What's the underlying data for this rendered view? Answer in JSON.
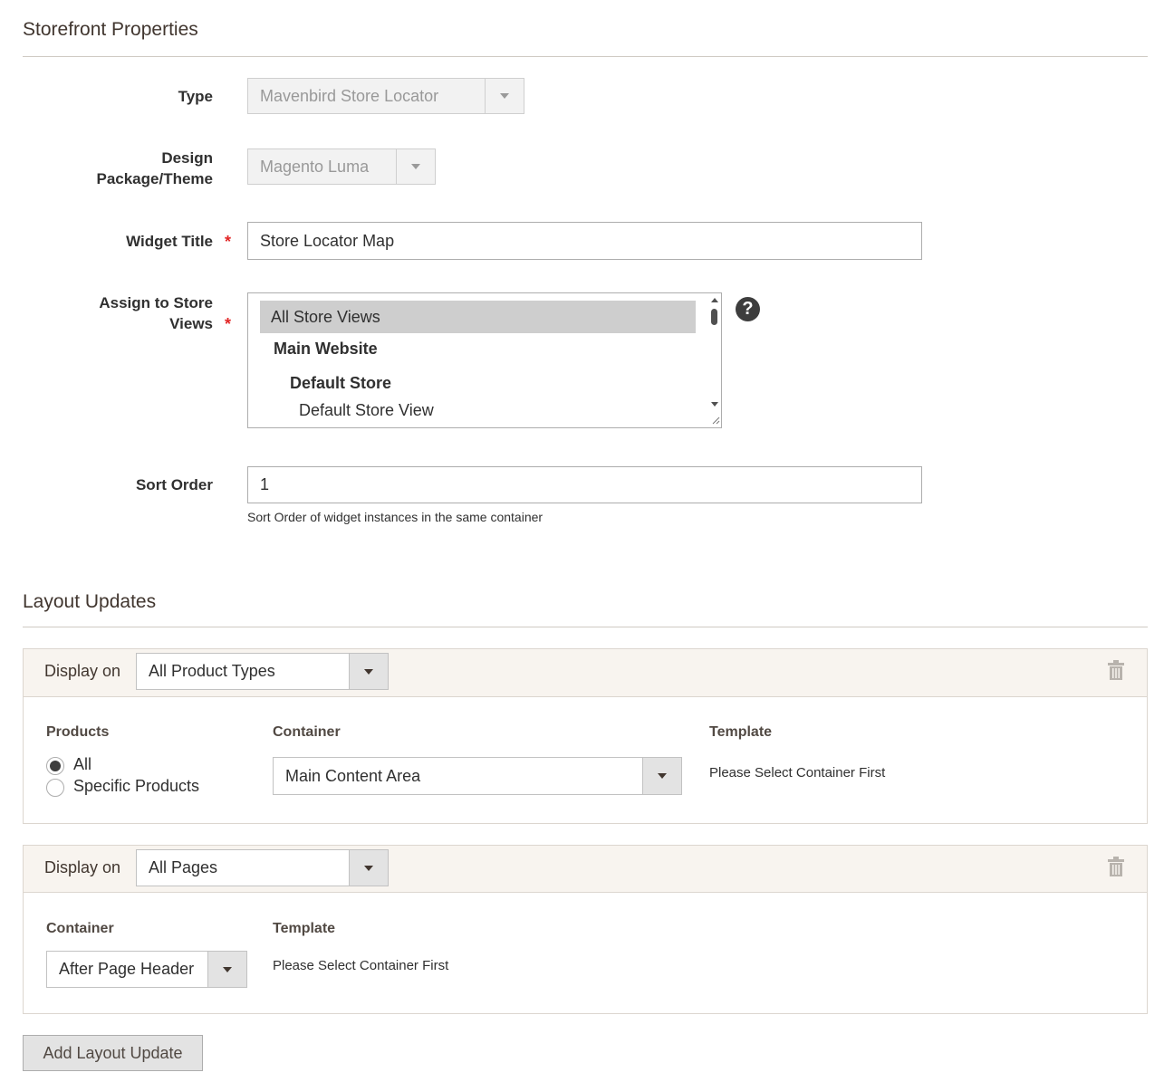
{
  "storefront": {
    "title": "Storefront Properties",
    "type_label": "Type",
    "type_value": "Mavenbird Store Locator",
    "design_label_1": "Design",
    "design_label_2": "Package/Theme",
    "design_value": "Magento Luma",
    "widget_title_label": "Widget Title",
    "widget_title_value": "Store Locator Map",
    "store_views_label_1": "Assign to Store",
    "store_views_label_2": "Views",
    "store_views_options": [
      "All Store Views",
      "Main Website",
      "Default Store",
      "Default Store View"
    ],
    "help_glyph": "?",
    "sort_order_label": "Sort Order",
    "sort_order_value": "1",
    "sort_order_note": "Sort Order of widget instances in the same container",
    "required_mark": "*"
  },
  "layout": {
    "title": "Layout Updates",
    "update1": {
      "display_on_label": "Display on",
      "display_on_value": "All Product Types",
      "products_title": "Products",
      "products_options": [
        "All",
        "Specific Products"
      ],
      "products_selected": "All",
      "container_title": "Container",
      "container_value": "Main Content Area",
      "template_title": "Template",
      "template_value": "Please Select Container First"
    },
    "update2": {
      "display_on_label": "Display on",
      "display_on_value": "All Pages",
      "container_title": "Container",
      "container_value": "After Page Header",
      "template_title": "Template",
      "template_value": "Please Select Container First"
    },
    "add_button": "Add Layout Update"
  },
  "icons": [
    "chevron-down-icon",
    "help-icon",
    "trash-icon"
  ],
  "colors": {
    "required": "#e22626",
    "panel_header_bg": "#f8f4ef",
    "selected_option_bg": "#cecece"
  }
}
